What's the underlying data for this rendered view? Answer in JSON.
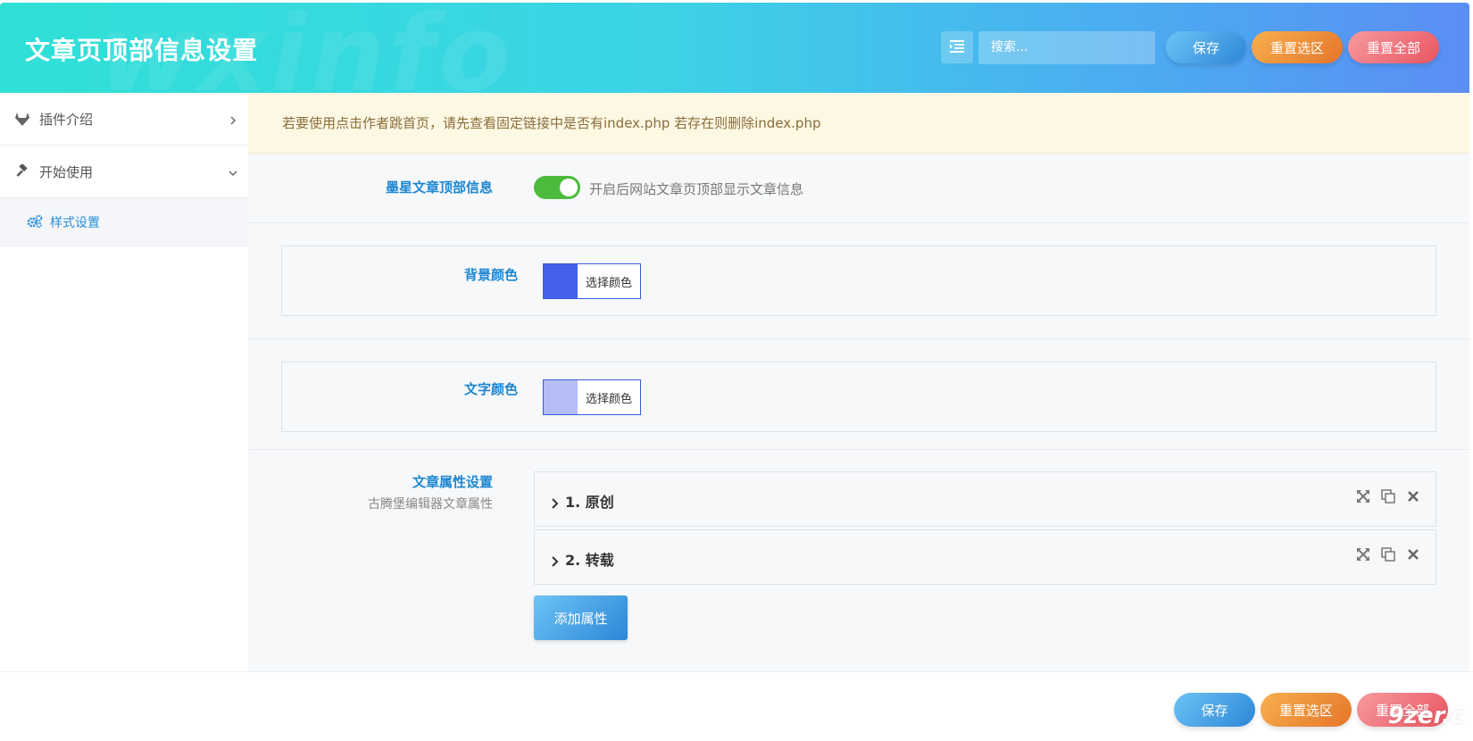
{
  "header": {
    "title": "文章页顶部信息设置",
    "watermark": "wxinfo",
    "search_placeholder": "搜索...",
    "save": "保存",
    "reset_section": "重置选区",
    "reset_all": "重置全部"
  },
  "sidebar": {
    "items": [
      {
        "label": "插件介绍",
        "icon": "gitlab-fox-icon",
        "chevron": "chevron-right-icon"
      },
      {
        "label": "开始使用",
        "icon": "gavel-icon",
        "chevron": "chevron-down-icon"
      }
    ],
    "sub_items": [
      {
        "label": "样式设置",
        "icon": "cogs-icon"
      }
    ]
  },
  "notice": "若要使用点击作者跳首页，请先查看固定链接中是否有index.php 若存在则删除index.php",
  "fields": {
    "toggle": {
      "label": "墨星文章顶部信息",
      "description": "开启后网站文章页顶部显示文章信息",
      "on": true
    },
    "bg_color": {
      "label": "背景颜色",
      "button": "选择颜色",
      "value": "#4560ea"
    },
    "text_color": {
      "label": "文字颜色",
      "button": "选择颜色",
      "value": "#b5bdf6"
    },
    "attributes": {
      "label": "文章属性设置",
      "sublabel": "古腾堡编辑器文章属性",
      "items": [
        {
          "title": "1. 原创"
        },
        {
          "title": "2. 转载"
        }
      ],
      "add_button": "添加属性"
    }
  },
  "footer": {
    "save": "保存",
    "reset_section": "重置选区",
    "reset_all": "重置全部",
    "brand": "9zer.c"
  },
  "colors": {
    "accent_blue": "#1e86d0",
    "switch_green": "#4cbb3d",
    "notice_bg": "#fdf8e4"
  }
}
